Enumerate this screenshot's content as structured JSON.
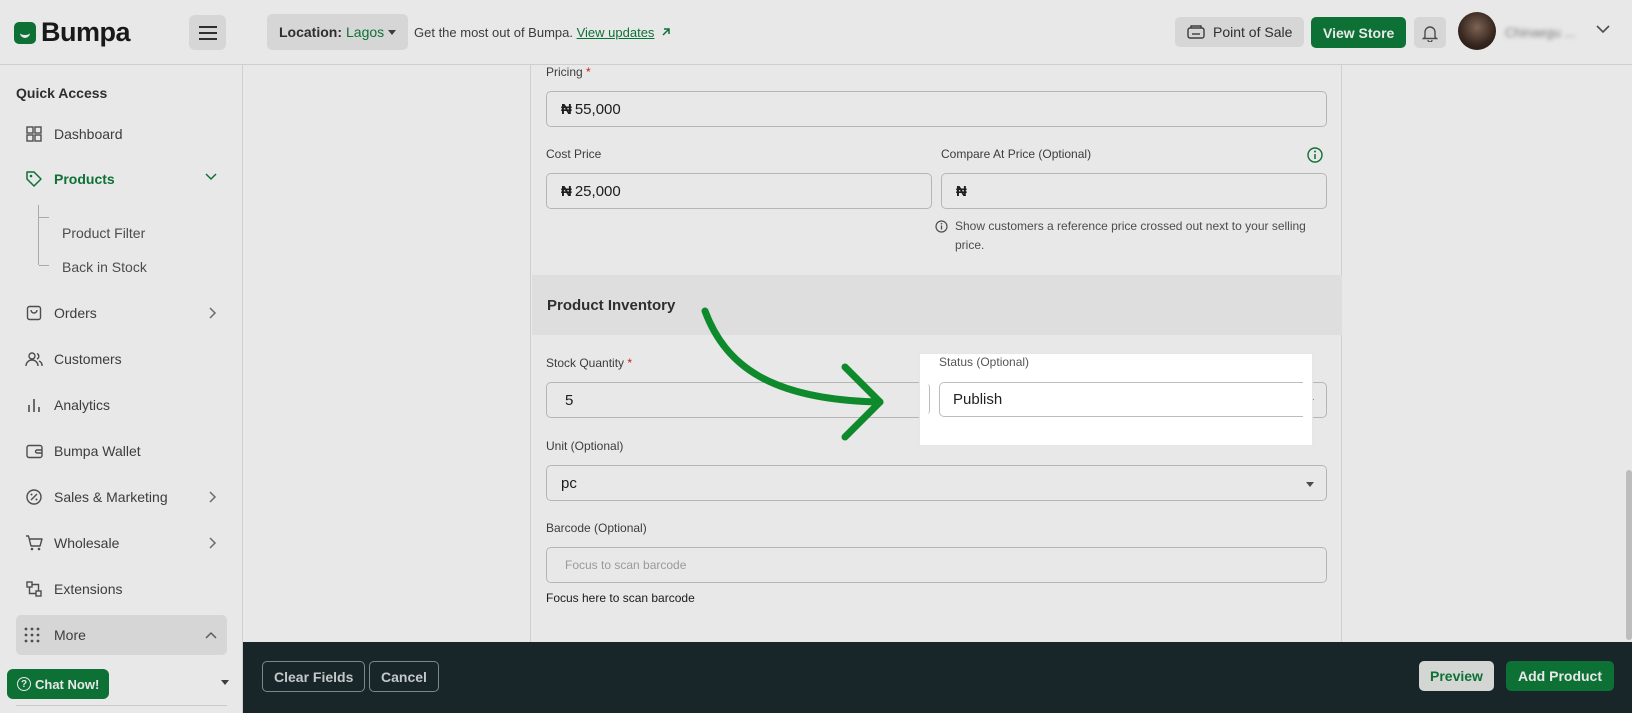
{
  "brand": {
    "name": "Bumpa",
    "accent": "#0f7d3b"
  },
  "topbar": {
    "location_label": "Location:",
    "location_value": "Lagos",
    "promo_text": "Get the most out of Bumpa.",
    "promo_link": "View updates",
    "pos_label": "Point of Sale",
    "view_store_label": "View Store",
    "username": "Chinaegu ..."
  },
  "sidebar": {
    "title": "Quick Access",
    "items": [
      {
        "label": "Dashboard",
        "icon": "grid-icon"
      },
      {
        "label": "Products",
        "icon": "tag-icon",
        "active": true
      },
      {
        "label": "Orders",
        "icon": "bag-icon"
      },
      {
        "label": "Customers",
        "icon": "users-icon"
      },
      {
        "label": "Analytics",
        "icon": "bar-chart-icon"
      },
      {
        "label": "Bumpa Wallet",
        "icon": "wallet-icon"
      },
      {
        "label": "Sales & Marketing",
        "icon": "percent-icon"
      },
      {
        "label": "Wholesale",
        "icon": "cart-icon"
      },
      {
        "label": "Extensions",
        "icon": "extensions-icon"
      }
    ],
    "sub_items": [
      "Product Filter",
      "Back in Stock"
    ],
    "more_label": "More",
    "chat_label": "Chat Now!"
  },
  "form": {
    "pricing_label": "Pricing",
    "pricing_value": "55,000",
    "cost_label": "Cost Price",
    "cost_value": "25,000",
    "compare_label": "Compare At Price (Optional)",
    "compare_value": "",
    "currency_symbol": "₦",
    "compare_hint": "Show customers a reference price crossed out next to your selling price.",
    "inventory_title": "Product Inventory",
    "stock_label": "Stock Quantity",
    "stock_value": "5",
    "status_label": "Status (Optional)",
    "status_value": "Publish",
    "unit_label": "Unit (Optional)",
    "unit_value": "pc",
    "barcode_label": "Barcode (Optional)",
    "barcode_placeholder": "Focus to scan barcode",
    "barcode_hint": "Focus here to scan barcode",
    "required_mark": "*"
  },
  "footer": {
    "clear_label": "Clear Fields",
    "cancel_label": "Cancel",
    "preview_label": "Preview",
    "add_label": "Add Product"
  }
}
